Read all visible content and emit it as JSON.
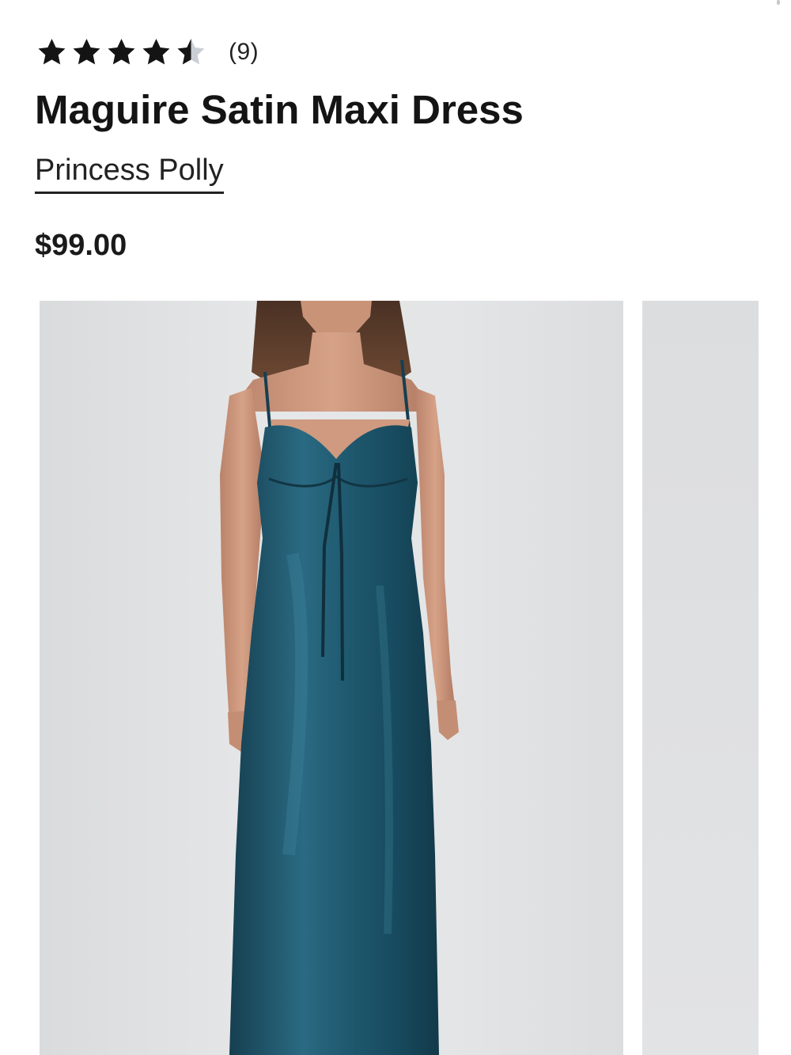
{
  "rating": {
    "value": 4.5,
    "max": 5,
    "count_label": "(9)"
  },
  "product": {
    "title": "Maguire Satin Maxi Dress",
    "brand": "Princess Polly",
    "price": "$99.00"
  },
  "gallery": {
    "images": [
      {
        "name": "product-photo-1",
        "color": "#1d5569"
      },
      {
        "name": "product-photo-2"
      }
    ]
  },
  "colors": {
    "text": "#141414",
    "star_filled": "#141414",
    "star_empty": "#c9cfd4",
    "dress": "#1d5569",
    "photo_background": "#e3e4e5"
  }
}
